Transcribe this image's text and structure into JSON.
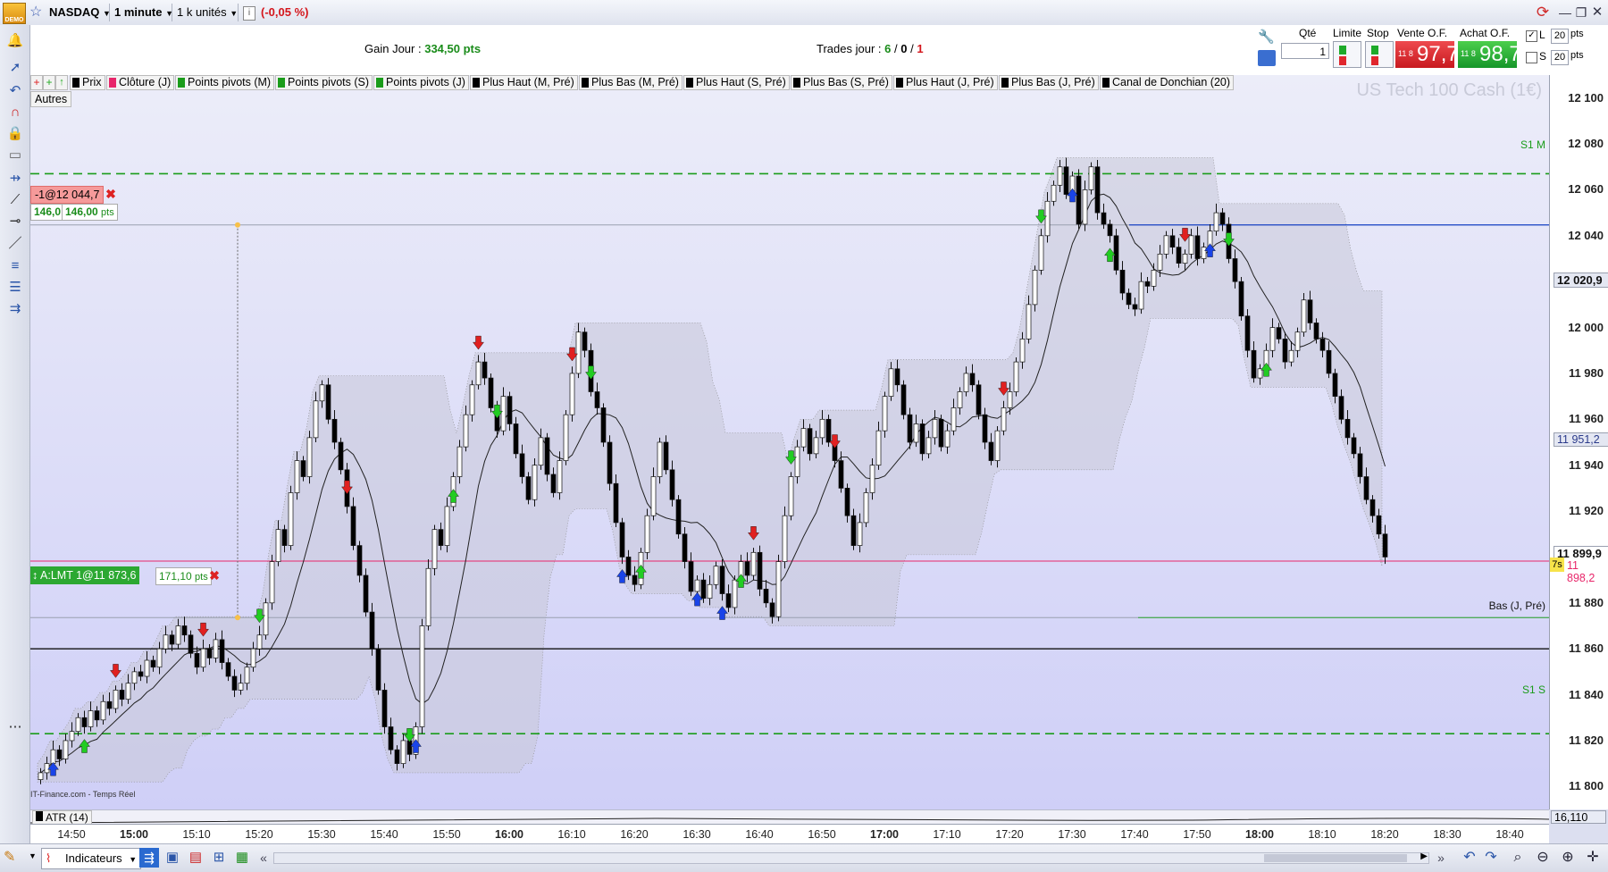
{
  "topbar": {
    "symbol": "NASDAQ",
    "timeframe": "1 minute",
    "units": "1 k unités",
    "change": "(-0,05 %)",
    "demo": "DEMO"
  },
  "info": {
    "gain_label": "Gain Jour :",
    "gain_value": "334,50 pts",
    "trades_label": "Trades jour :",
    "trades_a": "6",
    "trades_sep1": "/",
    "trades_b": "0",
    "trades_sep2": "/",
    "trades_c": "1"
  },
  "order_panel": {
    "qty_label": "Qté",
    "qty_value": "1",
    "limit_label": "Limite",
    "stop_label": "Stop",
    "sell_label": "Vente O.F.",
    "sell_prefix": "11 8",
    "sell_price": "97,7",
    "buy_label": "Achat O.F.",
    "buy_prefix": "11 8",
    "buy_price": "98,7",
    "l_label": "L",
    "s_label": "S",
    "l_pts": "20",
    "s_pts": "20",
    "pts_unit": "pts"
  },
  "indicators": [
    {
      "label": "Prix",
      "color": "#000000"
    },
    {
      "label": "Clôture (J)",
      "color": "#e8266a"
    },
    {
      "label": "Points pivots (M)",
      "color": "#1a9c1a"
    },
    {
      "label": "Points pivots (S)",
      "color": "#1a9c1a"
    },
    {
      "label": "Points pivots (J)",
      "color": "#1a9c1a"
    },
    {
      "label": "Plus Haut (M, Pré)",
      "color": "#000000"
    },
    {
      "label": "Plus Bas (M, Pré)",
      "color": "#000000"
    },
    {
      "label": "Plus Haut (S, Pré)",
      "color": "#000000"
    },
    {
      "label": "Plus Bas (S, Pré)",
      "color": "#000000"
    },
    {
      "label": "Plus Haut (J, Pré)",
      "color": "#000000"
    },
    {
      "label": "Plus Bas (J, Pré)",
      "color": "#000000"
    },
    {
      "label": "Canal de Donchian (20)",
      "color": "#000000"
    }
  ],
  "autres": "Autres",
  "watermark": "US Tech 100 Cash (1€)",
  "position_tag": {
    "label": "-1@12 044,7",
    "pts_a": "146,0",
    "pts_b": "146,00",
    "unit": "pts"
  },
  "order_tag": {
    "label": "A:LMT 1@11 873,6",
    "pts": "171,10",
    "unit": "pts"
  },
  "line_labels": {
    "s1m": "S1 M",
    "s1s": "S1 S",
    "bas_j": "Bas (J, Pré)"
  },
  "source": "IT-Finance.com - Temps Réel",
  "atr_label": "ATR (14)",
  "atr_value": "16,110",
  "y_axis": {
    "ticks": [
      "12 100",
      "12 080",
      "12 060",
      "12 040",
      "12 020,9",
      "12 000",
      "11 980",
      "11 960",
      "11 951,2",
      "11 940",
      "11 920",
      "11 899,9",
      "11 898,2",
      "11 880",
      "11 860",
      "11 840",
      "11 820",
      "11 800"
    ],
    "timer": "7s"
  },
  "x_axis": {
    "ticks": [
      {
        "label": "14:50",
        "bold": false
      },
      {
        "label": "15:00",
        "bold": true
      },
      {
        "label": "15:10",
        "bold": false
      },
      {
        "label": "15:20",
        "bold": false
      },
      {
        "label": "15:30",
        "bold": false
      },
      {
        "label": "15:40",
        "bold": false
      },
      {
        "label": "15:50",
        "bold": false
      },
      {
        "label": "16:00",
        "bold": true
      },
      {
        "label": "16:10",
        "bold": false
      },
      {
        "label": "16:20",
        "bold": false
      },
      {
        "label": "16:30",
        "bold": false
      },
      {
        "label": "16:40",
        "bold": false
      },
      {
        "label": "16:50",
        "bold": false
      },
      {
        "label": "17:00",
        "bold": true
      },
      {
        "label": "17:10",
        "bold": false
      },
      {
        "label": "17:20",
        "bold": false
      },
      {
        "label": "17:30",
        "bold": false
      },
      {
        "label": "17:40",
        "bold": false
      },
      {
        "label": "17:50",
        "bold": false
      },
      {
        "label": "18:00",
        "bold": true
      },
      {
        "label": "18:10",
        "bold": false
      },
      {
        "label": "18:20",
        "bold": false
      },
      {
        "label": "18:30",
        "bold": false
      },
      {
        "label": "18:40",
        "bold": false
      }
    ]
  },
  "bottombar": {
    "indicators_label": "Indicateurs"
  },
  "colors": {
    "up": "#ffffff",
    "down": "#000000",
    "sell": "#e0272d",
    "buy": "#1eaa2a",
    "accent": "#1a44c8"
  },
  "chart_data": {
    "type": "candlestick",
    "x_start": "14:46",
    "x_step_minutes": 1,
    "ylim": [
      11790,
      12110
    ],
    "closes": [
      11806,
      11810,
      11816,
      11812,
      11820,
      11824,
      11830,
      11826,
      11833,
      11829,
      11837,
      11834,
      11842,
      11838,
      11845,
      11850,
      11848,
      11855,
      11852,
      11860,
      11866,
      11862,
      11870,
      11866,
      11858,
      11852,
      11860,
      11856,
      11864,
      11854,
      11848,
      11842,
      11845,
      11852,
      11860,
      11866,
      11880,
      11898,
      11912,
      11905,
      11928,
      11942,
      11935,
      11952,
      11968,
      11975,
      11960,
      11950,
      11938,
      11922,
      11905,
      11892,
      11876,
      11860,
      11842,
      11826,
      11816,
      11810,
      11820,
      11814,
      11826,
      11870,
      11895,
      11912,
      11905,
      11922,
      11935,
      11948,
      11962,
      11975,
      11985,
      11978,
      11965,
      11955,
      11970,
      11958,
      11945,
      11935,
      11925,
      11940,
      11952,
      11936,
      11928,
      11942,
      11962,
      11980,
      11998,
      11990,
      11972,
      11965,
      11950,
      11932,
      11915,
      11900,
      11892,
      11888,
      11902,
      11918,
      11935,
      11950,
      11938,
      11925,
      11910,
      11898,
      11885,
      11890,
      11882,
      11888,
      11896,
      11884,
      11878,
      11890,
      11898,
      11892,
      11902,
      11886,
      11880,
      11874,
      11898,
      11918,
      11935,
      11948,
      11956,
      11945,
      11952,
      11960,
      11950,
      11942,
      11930,
      11918,
      11905,
      11915,
      11928,
      11940,
      11955,
      11970,
      11982,
      11975,
      11962,
      11950,
      11958,
      11945,
      11952,
      11960,
      11948,
      11955,
      11965,
      11972,
      11980,
      11975,
      11962,
      11950,
      11942,
      11955,
      11965,
      11972,
      11985,
      11995,
      12010,
      12025,
      12040,
      12055,
      12062,
      12070,
      12058,
      12066,
      12045,
      12060,
      12070,
      12050,
      12045,
      12040,
      12025,
      12015,
      12010,
      12008,
      12020,
      12018,
      12025,
      12032,
      12040,
      12035,
      12028,
      12032,
      12040,
      12030,
      12035,
      12042,
      12050,
      12045,
      12030,
      12020,
      12005,
      11990,
      11978,
      11982,
      11990,
      12000,
      11995,
      11985,
      11990,
      11998,
      12012,
      12002,
      11995,
      11990,
      11980,
      11970,
      11960,
      11952,
      11945,
      11935,
      11925,
      11918,
      11910,
      11900
    ]
  }
}
